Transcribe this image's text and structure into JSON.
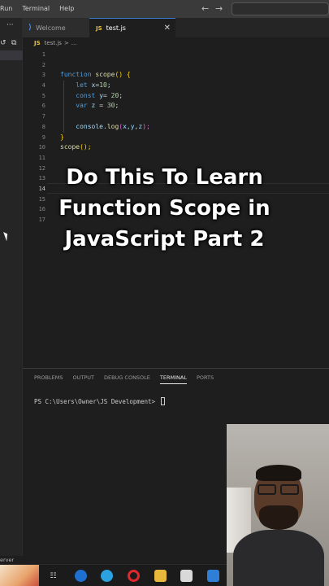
{
  "menu": {
    "items": [
      "Run",
      "Terminal",
      "Help"
    ]
  },
  "nav": {
    "back_icon": "arrow-left-icon",
    "forward_icon": "arrow-right-icon"
  },
  "sidebar": {
    "more": "···"
  },
  "tabs": [
    {
      "label": "Welcome",
      "icon": "vscode-icon",
      "active": false
    },
    {
      "label": "test.js",
      "icon": "js-file-icon",
      "active": true,
      "close": "✕"
    }
  ],
  "breadcrumb": {
    "icon": "JS",
    "file": "test.js",
    "separator": ">",
    "trail": "..."
  },
  "editor": {
    "line_numbers": [
      "1",
      "2",
      "3",
      "4",
      "5",
      "6",
      "7",
      "8",
      "9",
      "10",
      "11",
      "12",
      "13",
      "14",
      "15",
      "16",
      "17"
    ],
    "active_line": "14",
    "code": {
      "l3_kw": "function",
      "l3_fn": "scope",
      "l3_rest": "() {",
      "l4_kw": "let",
      "l4_var": "x",
      "l4_op": "=",
      "l4_num": "10",
      "l4_end": ";",
      "l5_kw": "const",
      "l5_var": "y",
      "l5_op": "= ",
      "l5_num": "20",
      "l5_end": ";",
      "l6_kw": "var",
      "l6_var": "z",
      "l6_op": " = ",
      "l6_num": "30",
      "l6_end": ";",
      "l8_obj": "console",
      "l8_dot": ".",
      "l8_fn": "log",
      "l8_open": "(",
      "l8_args": "x,y,z",
      "l8_close": ");",
      "l9": "}",
      "l10_fn": "scope",
      "l10_rest": "();"
    }
  },
  "caption": {
    "line1": "Do This To Learn",
    "line2": "Function Scope in",
    "line3": "JavaScript Part 2"
  },
  "panel": {
    "tabs": [
      "PROBLEMS",
      "OUTPUT",
      "DEBUG CONSOLE",
      "TERMINAL",
      "PORTS"
    ],
    "active_tab": "TERMINAL",
    "prompt": "PS C:\\Users\\Owner\\JS Development> "
  },
  "status": {
    "text": "erver"
  },
  "taskbar": {
    "icons": [
      "taskview-icon",
      "edge-dev-icon",
      "edge-icon",
      "opera-icon",
      "file-explorer-icon",
      "calendar-icon",
      "store-icon",
      "network-icon",
      "vscode-icon"
    ]
  },
  "colors": {
    "editor_bg": "#1e1e1e",
    "keyword": "#569cd6",
    "function": "#dcdcaa",
    "variable": "#9cdcfe",
    "number": "#b5cea8",
    "caption_text": "#ffffff"
  }
}
